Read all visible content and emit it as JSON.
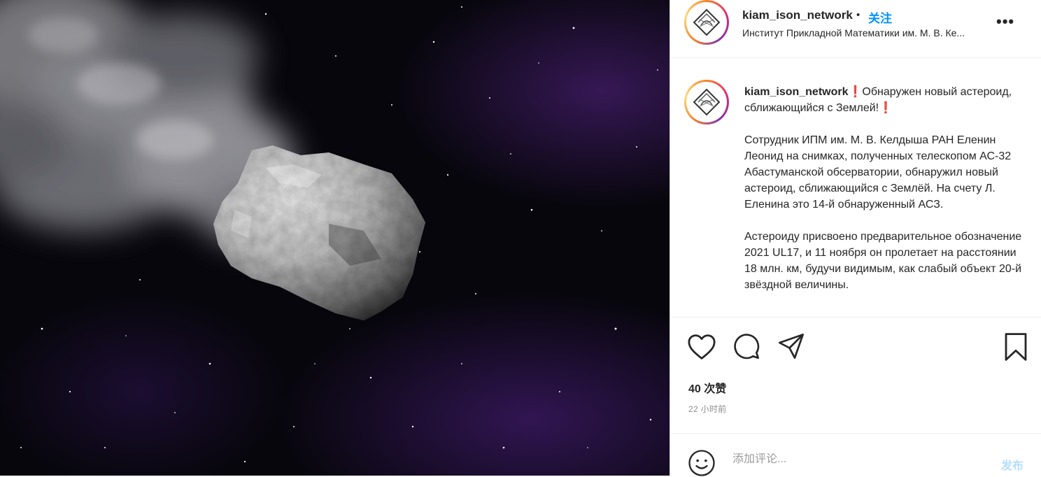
{
  "post": {
    "username": "kiam_ison_network",
    "follow_label": "关注",
    "separator": "•",
    "location": "Институт Прикладной Математики им. М. В. Ке...",
    "more_icon": "more-horizontal-icon",
    "more_label": "•••",
    "caption": {
      "username": "kiam_ison_network",
      "emoji_mark": "❗",
      "headline": "Обнаружен новый астероид, сближающийся с Землей!",
      "paragraph1": "Сотрудник ИПМ им. М. В. Келдыша РАН Еленин Леонид на снимках, полученных телескопом АС-32 Абастуманской обсерватории, обнаружил новый астероид, сближающийся с Землёй. На счету Л. Еленина это 14-й обнаруженный АСЗ.",
      "paragraph2": "Астероиду присвоено предварительное обозначение 2021 UL17, и 11 ноября он пролетает на расстоянии 18 млн. км, будучи видимым, как слабый объект 20-й звёздной величины."
    },
    "actions": {
      "like_icon": "heart-icon",
      "comment_icon": "comment-icon",
      "share_icon": "send-icon",
      "save_icon": "bookmark-icon"
    },
    "likes": "40 次赞",
    "timestamp": "22 小时前",
    "comment": {
      "emoji_icon": "smiley-icon",
      "placeholder": "添加评论...",
      "post_label": "发布"
    }
  },
  "media": {
    "description_icon": "asteroid-photo"
  },
  "colors": {
    "accent_blue": "#0095f6",
    "post_button_disabled": "#b2dffc",
    "alert_red": "#e03a2c",
    "muted_text": "#8e8e8e",
    "border": "#efefef"
  }
}
